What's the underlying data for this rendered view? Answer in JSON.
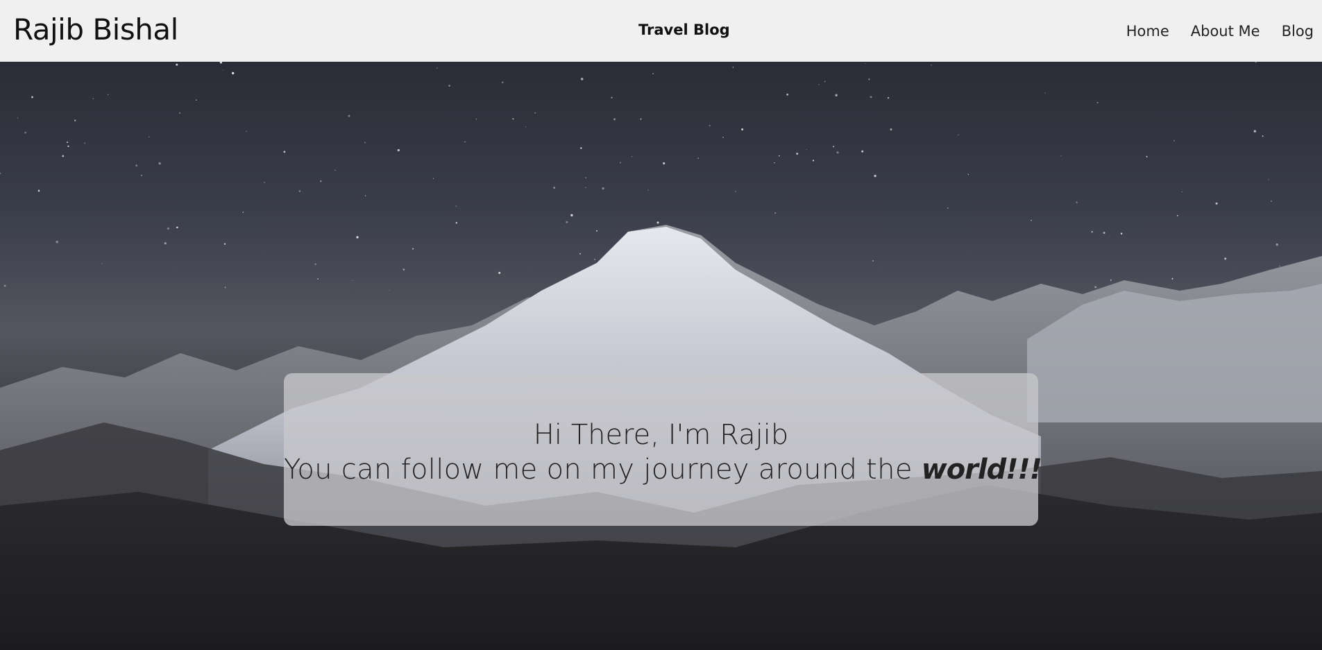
{
  "navbar": {
    "brand": "Rajib Bishal",
    "subtitle": "Travel Blog",
    "links": [
      "Home",
      "About Me",
      "Blog"
    ]
  },
  "hero": {
    "greeting": "Hi There, I'm Rajib",
    "tagline": "You can follow me on my journey around the",
    "emphasis": "world!!!",
    "background": "starry night sky over snow-capped mountains"
  },
  "colors": {
    "navbar_bg": "#f0f0f0",
    "text": "#111111",
    "card_bg": "rgba(200,200,204,0.78)"
  }
}
